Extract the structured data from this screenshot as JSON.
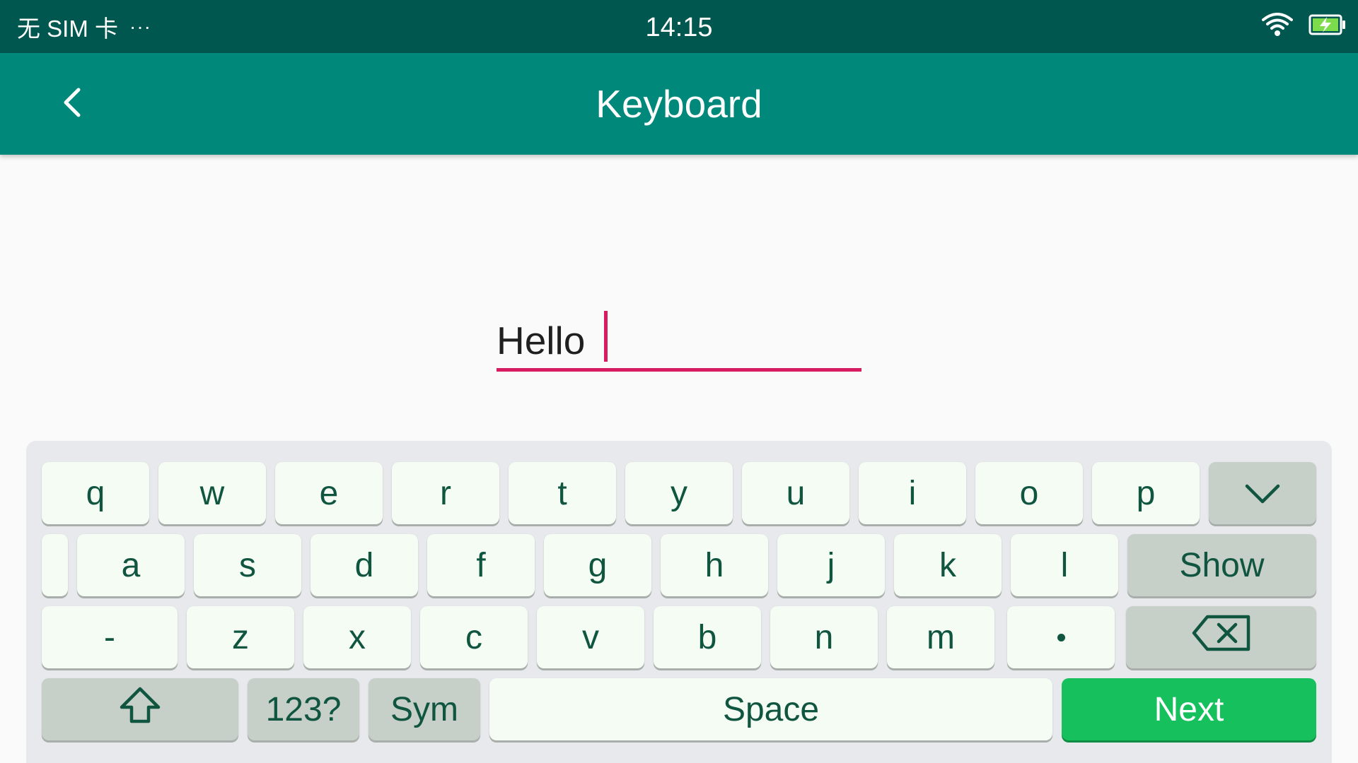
{
  "status_bar": {
    "carrier": "无 SIM 卡",
    "overflow": "···",
    "time": "14:15",
    "icons": [
      "wifi-icon",
      "battery-charging-icon"
    ]
  },
  "app_bar": {
    "title": "Keyboard",
    "back_icon": "chevron-left-icon"
  },
  "text_field": {
    "value": "Hello"
  },
  "keyboard": {
    "row1": [
      "q",
      "w",
      "e",
      "r",
      "t",
      "y",
      "u",
      "i",
      "o",
      "p"
    ],
    "row2": [
      "a",
      "s",
      "d",
      "f",
      "g",
      "h",
      "j",
      "k",
      "l"
    ],
    "row3": [
      "-",
      "z",
      "x",
      "c",
      "v",
      "b",
      "n",
      "m"
    ],
    "show_label": "Show",
    "numbers_label": "123?",
    "sym_label": "Sym",
    "space_label": "Space",
    "next_label": "Next",
    "hide_icon": "chevron-down-icon",
    "shift_icon": "shift-arrow-icon",
    "backspace_icon": "backspace-icon",
    "dot_key_icon": "dot-icon"
  },
  "colors": {
    "status_bar": "#00574f",
    "app_bar": "#00887a",
    "accent": "#d81b60",
    "key_text": "#10553f",
    "next_key": "#16c05c"
  }
}
